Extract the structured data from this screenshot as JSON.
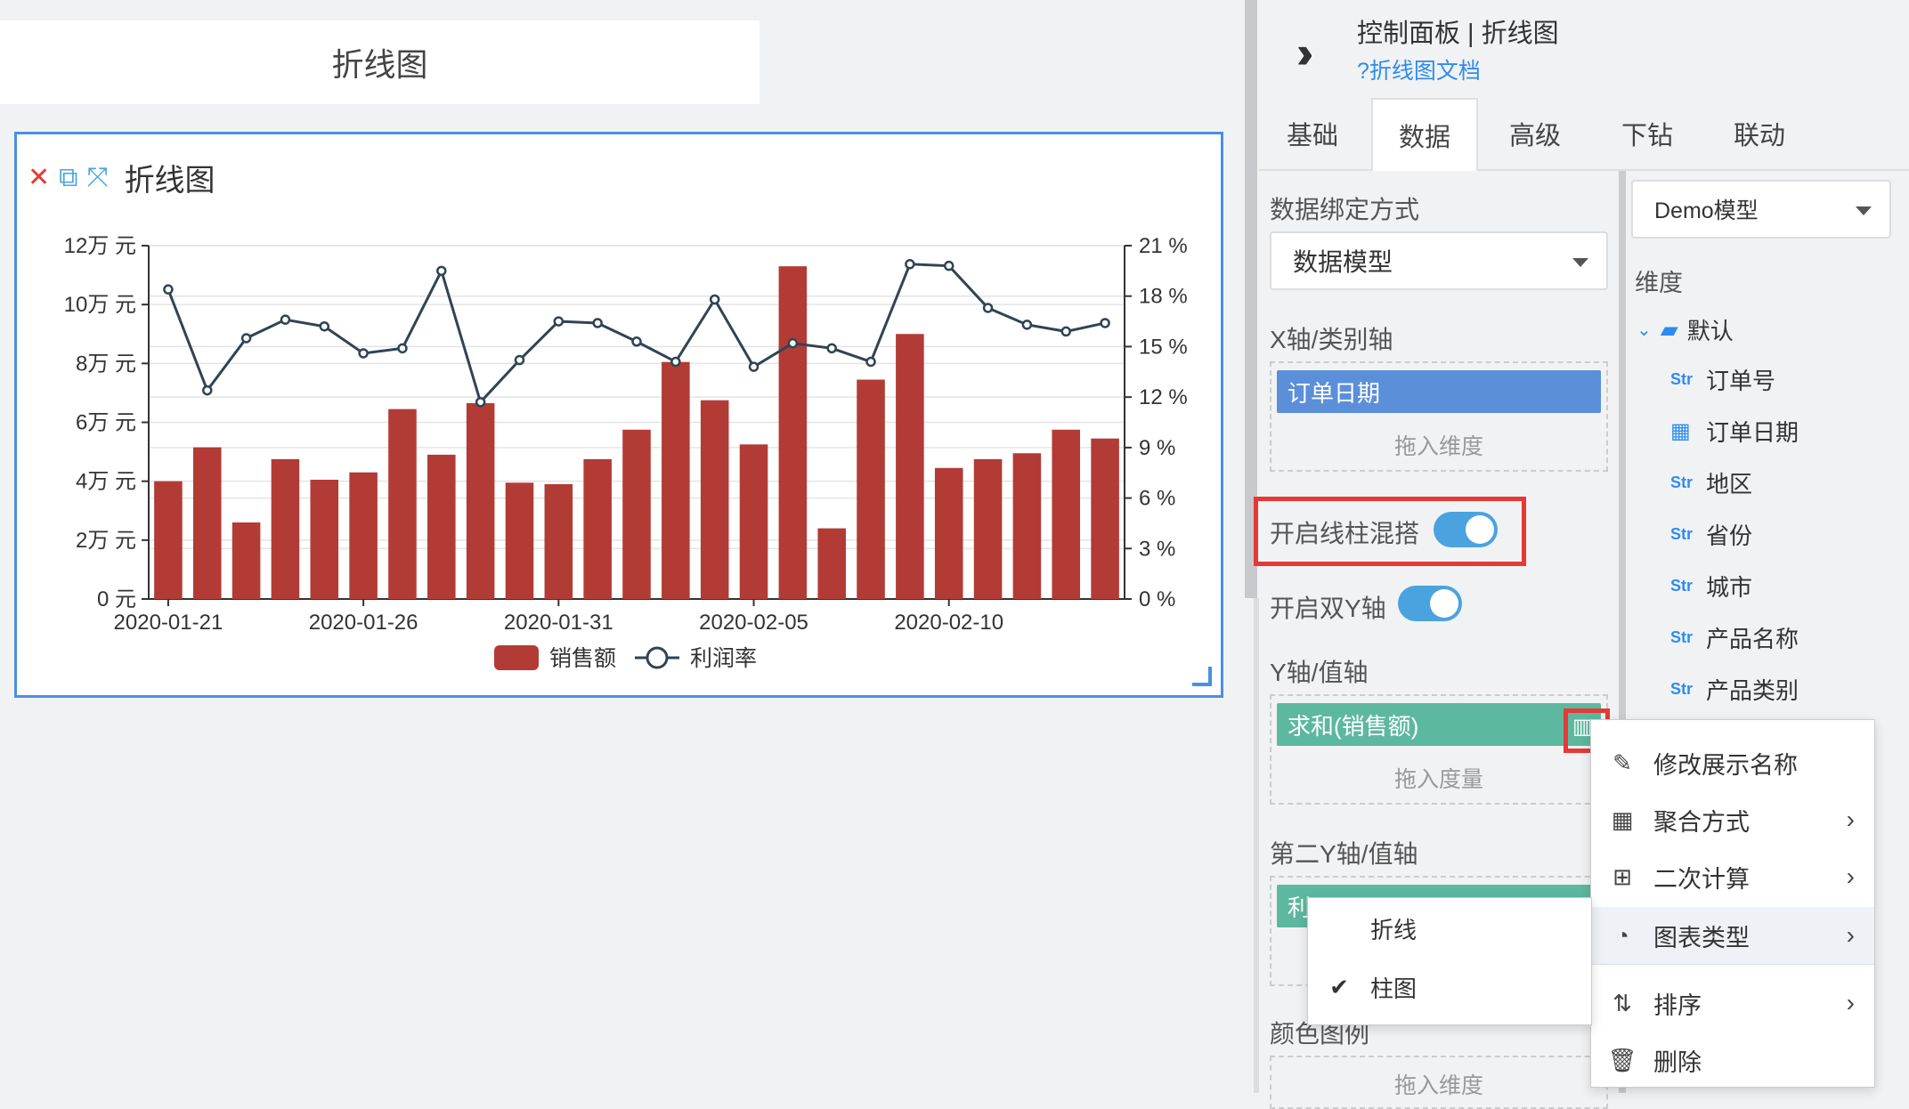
{
  "canvas": {
    "title_card": "折线图",
    "widget_title": "折线图",
    "icons": {
      "close": "close-icon",
      "copy": "copy-icon",
      "expand": "expand-icon"
    }
  },
  "chart_data": {
    "type": "bar+line",
    "title": "",
    "categories": [
      "2020-01-21",
      "2020-01-22",
      "2020-01-23",
      "2020-01-24",
      "2020-01-25",
      "2020-01-26",
      "2020-01-27",
      "2020-01-28",
      "2020-01-29",
      "2020-01-30",
      "2020-01-31",
      "2020-02-01",
      "2020-02-02",
      "2020-02-03",
      "2020-02-04",
      "2020-02-05",
      "2020-02-06",
      "2020-02-07",
      "2020-02-08",
      "2020-02-09",
      "2020-02-10",
      "2020-02-11",
      "2020-02-12",
      "2020-02-13",
      "2020-02-14"
    ],
    "x_tick_labels": [
      "2020-01-21",
      "2020-01-26",
      "2020-01-31",
      "2020-02-05",
      "2020-02-10"
    ],
    "x_tick_indices": [
      0,
      5,
      10,
      15,
      20
    ],
    "series": [
      {
        "name": "销售额",
        "kind": "bar",
        "axis": "left",
        "color": "#b33b35",
        "values": [
          40000,
          51500,
          26000,
          47500,
          40500,
          43000,
          64500,
          49000,
          66500,
          39500,
          39000,
          47500,
          57500,
          80500,
          67500,
          52500,
          113000,
          24000,
          74500,
          90000,
          44500,
          47500,
          49500,
          57500,
          54500
        ]
      },
      {
        "name": "利润率",
        "kind": "line",
        "axis": "right",
        "color": "#2f4454",
        "values": [
          18.4,
          12.4,
          15.5,
          16.6,
          16.2,
          14.6,
          14.9,
          19.5,
          11.7,
          14.2,
          16.5,
          16.4,
          15.3,
          14.1,
          17.8,
          13.8,
          15.2,
          14.9,
          14.1,
          19.9,
          19.8,
          17.3,
          16.3,
          15.9,
          16.4
        ]
      }
    ],
    "left_axis": {
      "ylim": [
        0,
        120000
      ],
      "tick_labels": [
        "0 元",
        "2万 元",
        "4万 元",
        "6万 元",
        "8万 元",
        "10万 元",
        "12万 元"
      ]
    },
    "right_axis": {
      "ylim": [
        0,
        21
      ],
      "tick_labels": [
        "0 %",
        "3 %",
        "6 %",
        "9 %",
        "12 %",
        "15 %",
        "18 %",
        "21 %"
      ]
    },
    "legend": {
      "placement": "bottom-center",
      "items": [
        "销售额",
        "利润率"
      ]
    },
    "grid": true
  },
  "panel": {
    "title": "控制面板 | 折线图",
    "doc_link": "?折线图文档",
    "tabs": [
      "基础",
      "数据",
      "高级",
      "下钻",
      "联动"
    ],
    "active_tab": "数据",
    "binding_label": "数据绑定方式",
    "binding_value": "数据模型",
    "x_axis_label": "X轴/类别轴",
    "x_axis_field": "订单日期",
    "x_axis_hint": "拖入维度",
    "mix_toggle_label": "开启线柱混搭",
    "dual_y_label": "开启双Y轴",
    "y_axis_label": "Y轴/值轴",
    "y_axis_field": "求和(销售额)",
    "y_axis_hint": "拖入度量",
    "y2_axis_label": "第二Y轴/值轴",
    "y2_axis_field": "利",
    "color_legend_label": "颜色图例",
    "color_legend_hint": "拖入维度"
  },
  "model": {
    "select_value": "Demo模型",
    "dimension_label": "维度",
    "folder": "默认",
    "fields": [
      {
        "type": "Str",
        "name": "订单号"
      },
      {
        "type": "date",
        "name": "订单日期"
      },
      {
        "type": "Str",
        "name": "地区"
      },
      {
        "type": "Str",
        "name": "省份"
      },
      {
        "type": "Str",
        "name": "城市"
      },
      {
        "type": "Str",
        "name": "产品名称"
      },
      {
        "type": "Str",
        "name": "产品类别"
      }
    ]
  },
  "context_menu": {
    "items": [
      "修改展示名称",
      "聚合方式",
      "二次计算",
      "图表类型",
      "排序",
      "删除"
    ],
    "highlighted": "图表类型"
  },
  "chart_type_submenu": {
    "items": [
      "折线",
      "柱图"
    ],
    "checked": "柱图"
  }
}
